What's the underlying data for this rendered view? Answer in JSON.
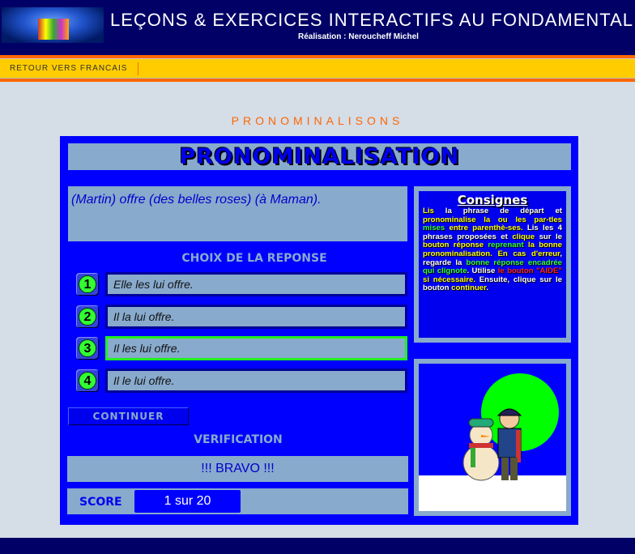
{
  "header": {
    "title": "LEÇONS & EXERCICES INTERACTIFS AU FONDAMENTAL",
    "author": "Réalisation : Neroucheff Michel",
    "logo_icon": "kids-logo"
  },
  "nav": {
    "back_link": "RETOUR VERS FRANCAIS"
  },
  "page_heading": "PRONOMINALISONS",
  "exercise": {
    "title": "PRONOMINALISATION",
    "sentence": "(Martin) offre (des belles roses) (à Maman).",
    "choices_label": "CHOIX DE LA REPONSE",
    "choices": [
      {
        "number": "1",
        "text": "Elle les lui offre.",
        "correct": false
      },
      {
        "number": "2",
        "text": "Il la lui offre.",
        "correct": false
      },
      {
        "number": "3",
        "text": "Il les lui offre.",
        "correct": true
      },
      {
        "number": "4",
        "text": "Il le lui offre.",
        "correct": false
      }
    ],
    "continue_button": "CONTINUER",
    "verification_label": "VERIFICATION",
    "verification_result": "!!! BRAVO !!!",
    "score_label": "SCORE",
    "score_value": "1 sur 20"
  },
  "instructions": {
    "title": "Consignes",
    "segments": [
      {
        "t": "Lis ",
        "c": "#ffff00"
      },
      {
        "t": "la phrase de départ et ",
        "c": "#ffffff"
      },
      {
        "t": "pronominalise ",
        "c": "#ffff00"
      },
      {
        "t": "la ou les par-tles ",
        "c": "#ffff00"
      },
      {
        "t": "mises ",
        "c": "#33ff33"
      },
      {
        "t": "entre parenthè-ses.",
        "c": "#ffff00"
      },
      {
        "t": " Lis les 4 phrases proposées et ",
        "c": "#ffffff"
      },
      {
        "t": "clique ",
        "c": "#ffff00"
      },
      {
        "t": "sur le ",
        "c": "#ffffff"
      },
      {
        "t": "bouton réponse ",
        "c": "#ffff00"
      },
      {
        "t": "reprenant ",
        "c": "#33ff33"
      },
      {
        "t": "la bonne ",
        "c": "#ffff00"
      },
      {
        "t": "pronominalisation.",
        "c": "#ffff00"
      },
      {
        "t": " En cas d'erreur",
        "c": "#ffff00"
      },
      {
        "t": ", regarde la ",
        "c": "#ffffff"
      },
      {
        "t": "bonne réponse encadrée qui clignote",
        "c": "#33ff33"
      },
      {
        "t": ". Utilise ",
        "c": "#ffffff"
      },
      {
        "t": "le bouton \"AIDE\" ",
        "c": "#ff2222"
      },
      {
        "t": "si nécessaire.",
        "c": "#ffff00"
      },
      {
        "t": " Ensuite, clique sur le bouton ",
        "c": "#ffffff"
      },
      {
        "t": "continuer",
        "c": "#ffff00"
      },
      {
        "t": ".",
        "c": "#ffffff"
      }
    ]
  },
  "colors": {
    "panel": "#0000ff",
    "frame": "#88aacc",
    "accent": "#ff6600",
    "nav": "#ffcc00",
    "header": "#000066",
    "correct": "#22ee22"
  }
}
